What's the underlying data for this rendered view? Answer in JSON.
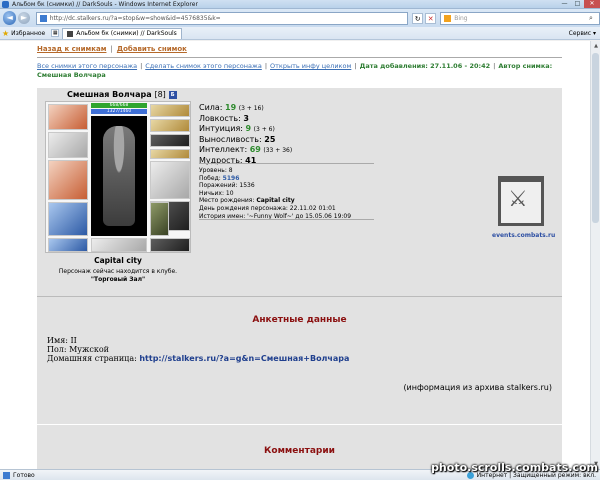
{
  "window": {
    "title": "Альбом бк (снимки) // DarkSouls - Windows Internet Explorer",
    "minimize": "—",
    "maximize": "□",
    "close": "✕"
  },
  "browser": {
    "back": "◄",
    "forward": "►",
    "url": "http://dc.stalkers.ru/?a=stop&w=show&id=4576835&k=",
    "search_engine": "Bing",
    "search_icon": "⌕",
    "refresh": "↻",
    "stop": "✕",
    "favorites_label": "Избранное",
    "tab_label": "Альбом бк (снимки) // DarkSouls",
    "service_menu": "Сервис ▾"
  },
  "nav": {
    "back_link": "Назад к снимкам",
    "add_link": "Добавить снимок",
    "sep": "|"
  },
  "info": {
    "all_shots": "Все снимки этого персонажа",
    "make_shot": "Сделать снимок этого персонажа",
    "open_info": "Открыть инфу целиком",
    "date_added_label": "Дата добавления: 27.11.06 - 20:42",
    "author_label": "Автор снимка: Смешная Волчара"
  },
  "character": {
    "name": "Смешная Волчара",
    "level": "[8]",
    "badge": "Б",
    "hp": "668/668",
    "mp": "1327/1460",
    "city": "Capital city",
    "club_line": "Персонаж сейчас находится в клубе.",
    "club_room": "\"Торговый Зал\""
  },
  "stats": [
    {
      "label": "Сила:",
      "value": "19",
      "mod": "(3 + 16)",
      "green": true
    },
    {
      "label": "Ловкость:",
      "value": "3",
      "mod": "",
      "green": false
    },
    {
      "label": "Интуиция:",
      "value": "9",
      "mod": "(3 + 6)",
      "green": true
    },
    {
      "label": "Выносливость:",
      "value": "25",
      "mod": "",
      "green": false
    },
    {
      "label": "Интеллект:",
      "value": "69",
      "mod": "(33 + 36)",
      "green": true
    },
    {
      "label": "Мудрость:",
      "value": "41",
      "mod": "",
      "green": false
    }
  ],
  "details": {
    "level": "Уровень: 8",
    "wins_label": "Побед:",
    "wins": "5196",
    "losses": "Поражений: 1536",
    "draws": "Ничьих: 10",
    "birthplace_label": "Место рождения:",
    "birthplace": "Capital city",
    "birthday": "День рождения персонажа: 22.11.02 01:01",
    "history": "История имен: '~Funny Wolf~' до 15.05.06 19:09"
  },
  "emblem": {
    "caption": "events.combats.ru"
  },
  "anketa": {
    "title": "Анкетные данные",
    "name_line": "Имя: II",
    "gender_line": "Пол: Мужской",
    "homepage_label": "Домашняя страница:",
    "homepage_url": "http://stalkers.ru/?a=g&n=Смешная+Волчара",
    "archive_note": "(информация из архива stalkers.ru)"
  },
  "comments": {
    "title": "Комментарии"
  },
  "status": {
    "ready": "Готово",
    "zone": "Интернет | Защищенный режим: вкл.",
    "zoom": "100%"
  },
  "watermark": "photo.scrolls.combats.com",
  "colors": {
    "link_orange": "#b5692a",
    "info_green": "#2e7d32",
    "heading_red": "#8b1010",
    "panel_grey": "#e2e2e2"
  }
}
